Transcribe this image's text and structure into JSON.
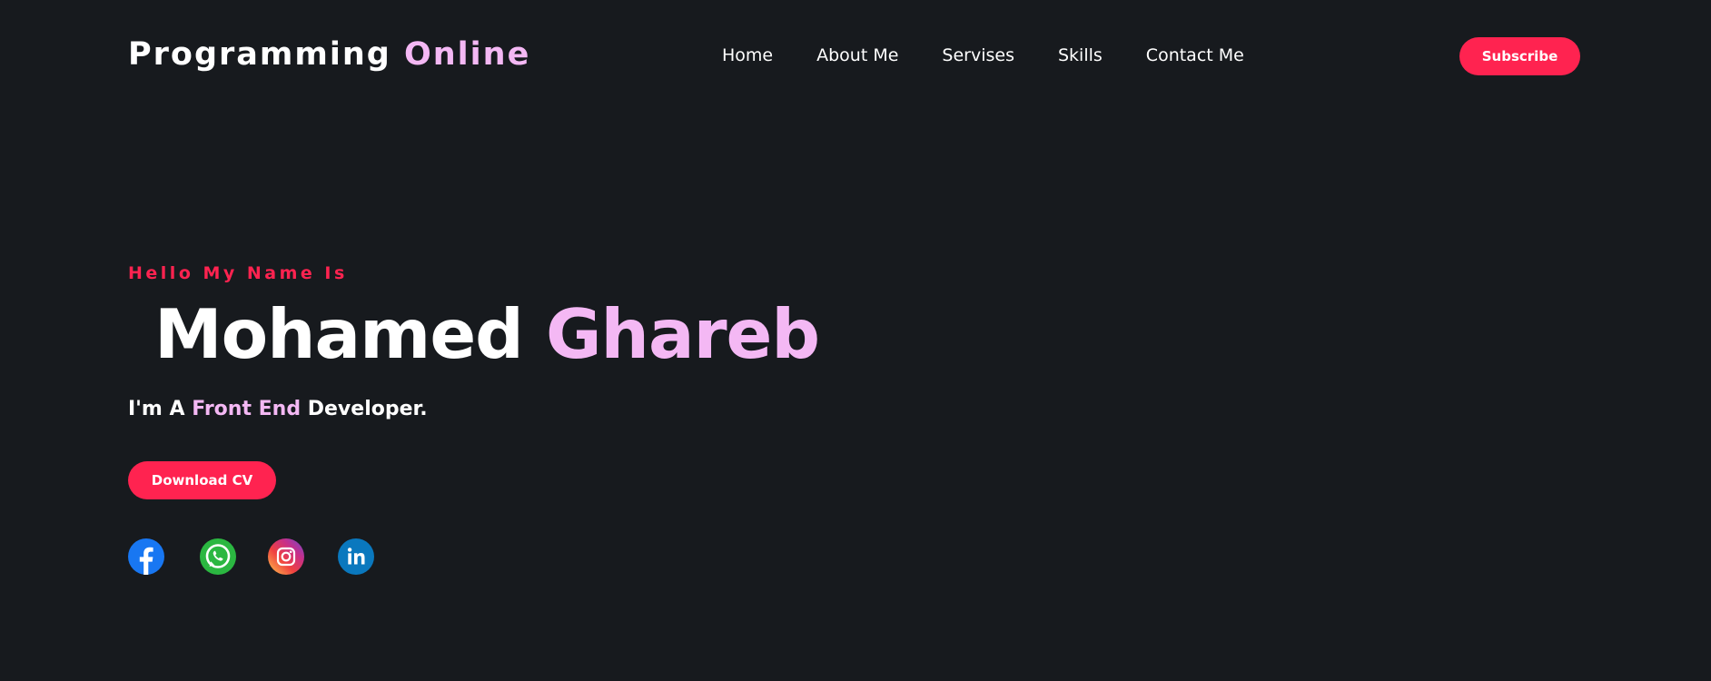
{
  "header": {
    "logo_main": "Programming",
    "logo_accent": "Online",
    "nav": [
      {
        "label": "Home"
      },
      {
        "label": "About Me"
      },
      {
        "label": "Servises"
      },
      {
        "label": "Skills"
      },
      {
        "label": "Contact Me"
      }
    ],
    "subscribe_label": "Subscribe"
  },
  "hero": {
    "greeting": "Hello My Name Is",
    "first_name": "Mohamed",
    "last_name": "Ghareb",
    "role_prefix": "I'm A",
    "role_highlight": "Front End",
    "role_suffix": "Developer.",
    "cv_label": "Download CV"
  },
  "socials": [
    {
      "icon": "facebook-icon"
    },
    {
      "icon": "whatsapp-icon"
    },
    {
      "icon": "instagram-icon"
    },
    {
      "icon": "linkedin-icon"
    }
  ],
  "colors": {
    "background": "#171a1e",
    "accent_pink": "#f4b8f4",
    "accent_red": "#ff2350",
    "text": "#ffffff"
  }
}
